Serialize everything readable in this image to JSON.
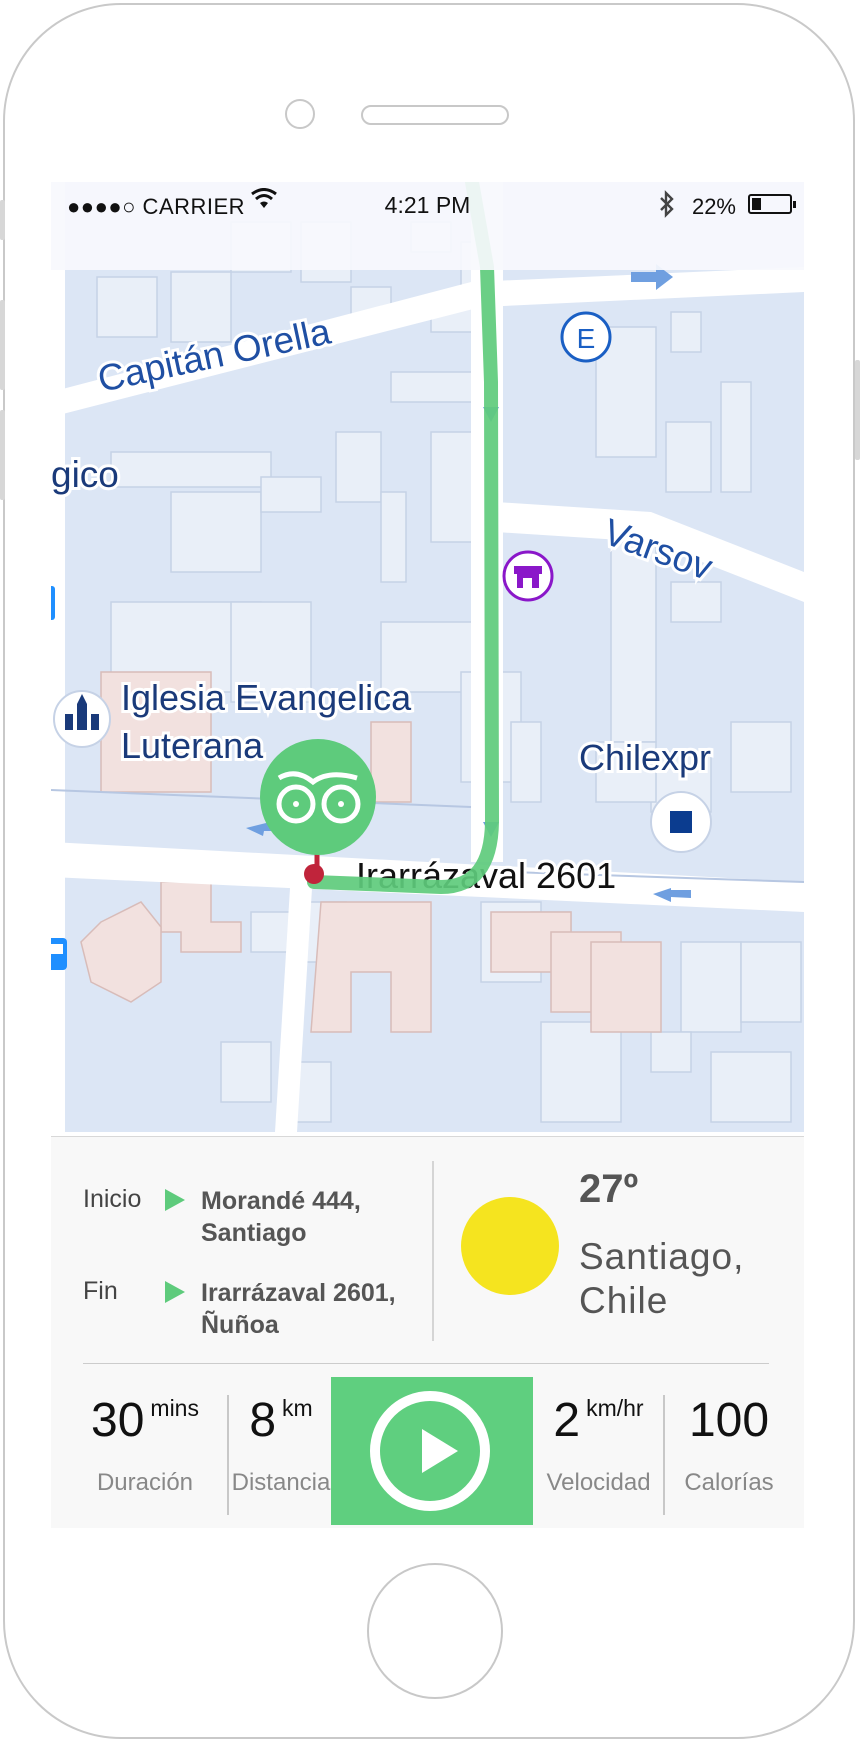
{
  "status_bar": {
    "carrier": "●●●●○ CARRIER",
    "time": "4:21 PM",
    "battery_percent": "22%",
    "battery_level": 0.22
  },
  "map": {
    "street_capitan_orella": "Capitán Orella",
    "street_varsovia": "Varsov",
    "label_gico": "gico",
    "poi_iglesia_line1": "Iglesia Evangelica",
    "poi_iglesia_line2": "Luterana",
    "poi_chilexpress": "Chilexpr",
    "destination_label": "Irarrázaval 2601",
    "station_badge": "E",
    "colors": {
      "route": "#5ecb7c",
      "water_blue": "#1a5fc4",
      "shop_purple": "#8a17c9",
      "marker_red": "#c0243b"
    }
  },
  "route": {
    "start_label": "Inicio",
    "start_addr": "Morandé 444, Santiago",
    "end_label": "Fin",
    "end_addr": "Irarrázaval 2601, Ñuñoa"
  },
  "weather": {
    "temperature": "27º",
    "city": "Santiago, Chile"
  },
  "stats": {
    "duration_value": "30",
    "duration_unit": "mins",
    "duration_label": "Duración",
    "distance_value": "8",
    "distance_unit": "km",
    "distance_label": "Distancia",
    "speed_value": "2",
    "speed_unit": "km/hr",
    "speed_label": "Velocidad",
    "calories_value": "100",
    "calories_label": "Calorías"
  },
  "icons": {
    "play": "play-icon",
    "tripadvisor": "owl-eyes-icon",
    "stop": "stop-icon",
    "church": "church-icon",
    "shop": "shop-icon",
    "bus": "bus-icon",
    "wifi": "wifi-icon",
    "bluetooth": "bluetooth-icon"
  }
}
